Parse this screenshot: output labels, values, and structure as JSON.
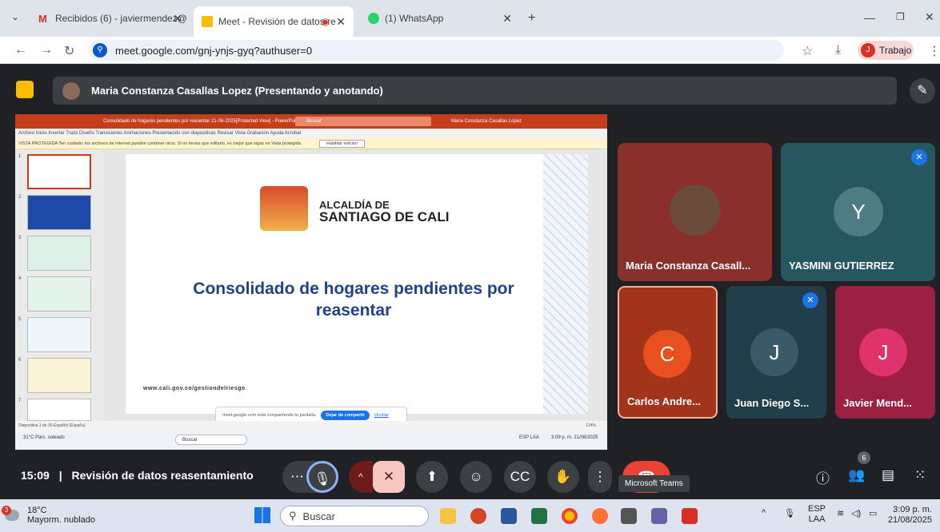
{
  "browser": {
    "tabs": [
      {
        "title": "Recibidos (6) - javiermendez@",
        "icon": "gmail-icon",
        "color": "#d93025"
      },
      {
        "title": "Meet - Revisión de datos re",
        "icon": "meet-icon",
        "color": "#fbbc04"
      },
      {
        "title": "(1) WhatsApp",
        "icon": "whatsapp-icon",
        "color": "#25d366"
      }
    ],
    "url": "meet.google.com/gnj-ynjs-gyq?authuser=0",
    "profile_label": "Trabajo",
    "profile_initial": "J"
  },
  "meet": {
    "presenter_text": "Maria Constanza Casallas Lopez (Presentando y anotando)",
    "participants": [
      {
        "name": "Maria Constanza Casall...",
        "initial": "",
        "color": "#8a2f2b",
        "muted": false
      },
      {
        "name": "YASMINI GUTIERREZ",
        "initial": "Y",
        "color": "#27575e",
        "muted": true
      },
      {
        "name": "Carlos Andre...",
        "initial": "C",
        "color": "#a1341b",
        "muted": false
      },
      {
        "name": "Juan Diego S...",
        "initial": "J",
        "color": "#213f4b",
        "muted": true
      },
      {
        "name": "Javier Mend...",
        "initial": "J",
        "color": "#9c2042",
        "muted": false
      }
    ],
    "time": "15:09",
    "separator": "|",
    "meeting_title": "Revisión de datos reasentamiento",
    "tooltip": "Microsoft Teams",
    "people_count": "6"
  },
  "presentation": {
    "window_title": "Consolidado de hogares pendientes por reasentar 21-06-2025[Protected View] - PowerPoint",
    "search_label": "Buscar",
    "user": "Maria Constanza Casallas Lopez",
    "menu": "Archivo   Inicio   Insertar   Trazo   Diseño   Transiciones   Animaciones   Presentación con diapositivas   Revisar   Vista   Grabación   Ayuda   Acrobat",
    "warning": "VISTA PROTEGIDA  Ten cuidado: los archivos de Internet pueden contener virus. Si no tienes que editarlo, es mejor que sigas en Vista protegida.",
    "enable_edit": "Habilitar edición",
    "slide_numbers": [
      "1",
      "2",
      "3",
      "4",
      "5",
      "6",
      "7"
    ],
    "logo_line1": "ALCALDÍA DE",
    "logo_line2": "SANTIAGO DE CALI",
    "slide_title": "Consolidado de hogares pendientes por reasentar",
    "slide_url": "www.cali.gov.co/gestiondelriesgo",
    "share_notice": "meet.google.com está compartiendo tu pantalla.",
    "stop_share": "Dejar de compartir",
    "hide": "Ocultar",
    "status": "Diapositiva 1 de 30    Español (España)",
    "zoom": "124%",
    "inner_weather": "31°C Parc. soleado",
    "inner_clock": "3:09 p. m. 21/08/2025",
    "inner_lang": "ESP LAA"
  },
  "taskbar": {
    "temp": "18°C",
    "weather": "Mayorm. nublado",
    "weather_badge": "3",
    "search": "Buscar",
    "lang1": "ESP",
    "lang2": "LAA",
    "time": "3:09 p. m.",
    "date": "21/08/2025"
  }
}
